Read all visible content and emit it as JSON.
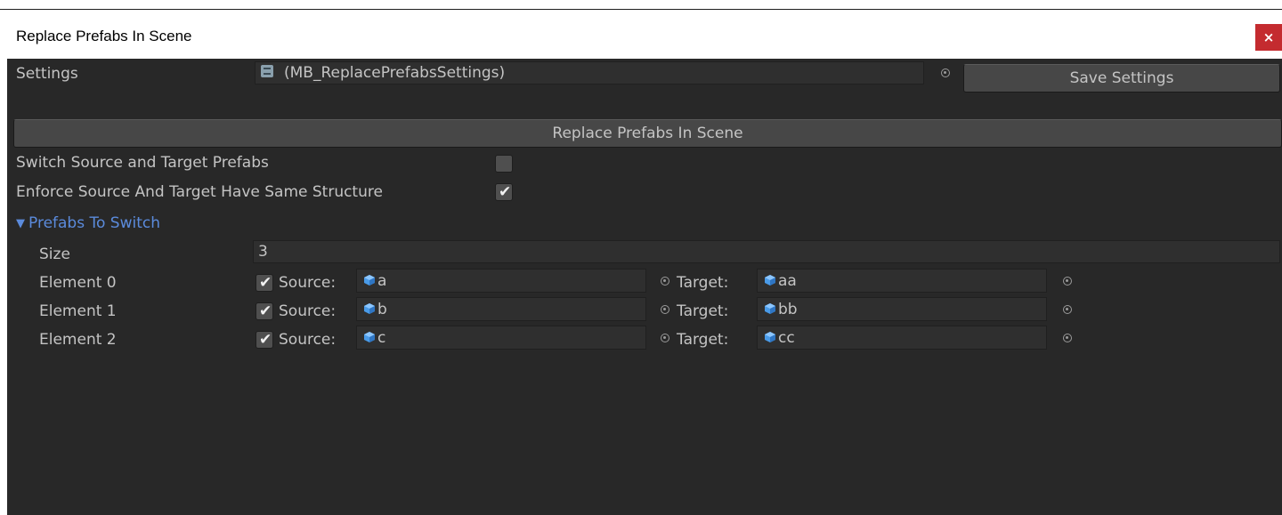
{
  "window": {
    "title": "Replace Prefabs In Scene",
    "close_label": "×"
  },
  "settings": {
    "label": "Settings",
    "object_value": "(MB_ReplacePrefabsSettings)",
    "save_button": "Save Settings"
  },
  "actions": {
    "replace_button": "Replace Prefabs In Scene"
  },
  "options": {
    "switch_label": "Switch Source and Target Prefabs",
    "switch_checked": false,
    "enforce_label": "Enforce Source And Target Have Same Structure",
    "enforce_checked": true
  },
  "prefabs": {
    "foldout_label": "Prefabs To Switch",
    "size_label": "Size",
    "size_value": "3",
    "source_label": "Source:",
    "target_label": "Target:",
    "elements": [
      {
        "label": "Element 0",
        "checked": true,
        "source": "a",
        "target": "aa"
      },
      {
        "label": "Element 1",
        "checked": true,
        "source": "b",
        "target": "bb"
      },
      {
        "label": "Element 2",
        "checked": true,
        "source": "c",
        "target": "cc"
      }
    ]
  },
  "colors": {
    "panel_bg": "#282828",
    "text": "#c4c4c4",
    "foldout": "#5b8bdc",
    "close_bg": "#c42b2f",
    "prefab_icon": "#4a9be8"
  },
  "icons": {
    "close": "close-icon",
    "script": "scriptable-object-icon",
    "picker": "object-picker-icon",
    "prefab": "prefab-cube-icon",
    "foldout": "foldout-arrow-icon",
    "check": "checkmark-icon"
  }
}
